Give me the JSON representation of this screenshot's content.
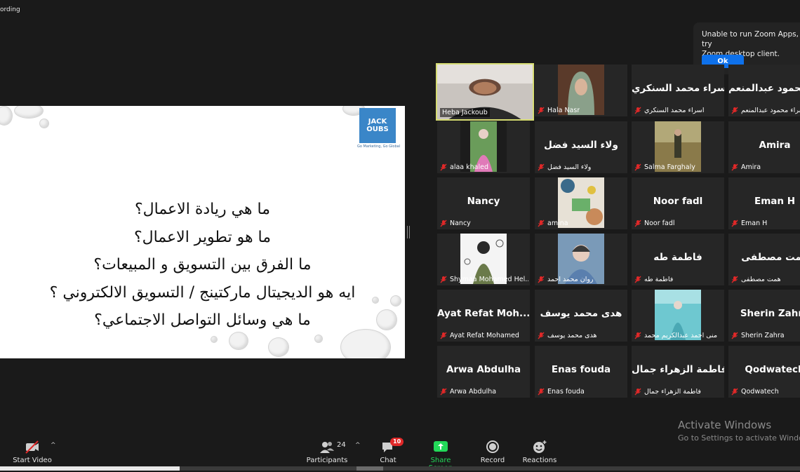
{
  "recording_text": "ording",
  "toast": {
    "message": "Unable to run Zoom Apps, try\nZoom desktop client.",
    "ok_label": "Ok"
  },
  "slide": {
    "logo_text": "JACK\nOUBS",
    "logo_tagline": "Go Marketing, Go Global",
    "questions": [
      "ما هي ريادة الاعمال؟",
      "ما هو تطوير الاعمال؟",
      "ما الفرق بين التسويق و المبيعات؟",
      "ايه هو الديجيتال ماركتينج / التسويق الالكتروني ؟",
      "ما هي وسائل التواصل الاجتماعي؟"
    ]
  },
  "participants": [
    {
      "label": "Heba Jackoub",
      "big": "",
      "muted": false,
      "active": true,
      "photo": "person"
    },
    {
      "label": "Hala Nasr",
      "big": "",
      "muted": true,
      "active": false,
      "photo": "hijab-green"
    },
    {
      "label": "اسراء محمد السنكري",
      "big": "اسراء محمد السنكري",
      "muted": true,
      "active": false,
      "photo": ""
    },
    {
      "label": "اسراء محمود عبدالمنعم",
      "big": "اسراء محمود عبدالمنعم",
      "muted": true,
      "active": false,
      "photo": ""
    },
    {
      "label": "alaa khaled",
      "big": "",
      "muted": true,
      "active": false,
      "photo": "pink-girl"
    },
    {
      "label": "ولاء السيد فضل",
      "big": "ولاء السيد فضل",
      "muted": true,
      "active": false,
      "photo": ""
    },
    {
      "label": "Salma Farghaly",
      "big": "",
      "muted": true,
      "active": false,
      "photo": "field"
    },
    {
      "label": "Amira",
      "big": "Amira",
      "muted": true,
      "active": false,
      "photo": ""
    },
    {
      "label": "Nancy",
      "big": "Nancy",
      "muted": true,
      "active": false,
      "photo": ""
    },
    {
      "label": "amina",
      "big": "",
      "muted": true,
      "active": false,
      "photo": "craft"
    },
    {
      "label": "Noor fadl",
      "big": "Noor fadl",
      "muted": true,
      "active": false,
      "photo": ""
    },
    {
      "label": "Eman H",
      "big": "Eman H",
      "muted": true,
      "active": false,
      "photo": ""
    },
    {
      "label": "Shymaa Mohamed Hel...",
      "big": "",
      "muted": true,
      "active": false,
      "photo": "cartoon"
    },
    {
      "label": "روان محمد احمد",
      "big": "",
      "muted": true,
      "active": false,
      "photo": "blue-girl"
    },
    {
      "label": "فاطمة طه",
      "big": "فاطمة طه",
      "muted": true,
      "active": false,
      "photo": ""
    },
    {
      "label": "همت مصطفى",
      "big": "همت مصطفى",
      "muted": true,
      "active": false,
      "photo": ""
    },
    {
      "label": "Ayat Refat Mohamed",
      "big": "Ayat Refat Moh...",
      "muted": true,
      "active": false,
      "photo": ""
    },
    {
      "label": "هدى محمد يوسف",
      "big": "هدى محمد يوسف",
      "muted": true,
      "active": false,
      "photo": ""
    },
    {
      "label": "منى احمد عبدالكريم محمد",
      "big": "",
      "muted": true,
      "active": false,
      "photo": "teal"
    },
    {
      "label": "Sherin Zahra",
      "big": "Sherin Zahra",
      "muted": true,
      "active": false,
      "photo": ""
    },
    {
      "label": "Arwa Abdulha",
      "big": "Arwa Abdulha",
      "muted": true,
      "active": false,
      "photo": ""
    },
    {
      "label": "Enas fouda",
      "big": "Enas fouda",
      "muted": true,
      "active": false,
      "photo": ""
    },
    {
      "label": "فاطمة الزهراء جمال",
      "big": "فاطمة الزهراء جمال",
      "muted": true,
      "active": false,
      "photo": ""
    },
    {
      "label": "Qodwatech",
      "big": "Qodwatech",
      "muted": true,
      "active": false,
      "photo": ""
    }
  ],
  "toolbar": {
    "start_video": "Start Video",
    "participants_label": "Participants",
    "participants_count": "24",
    "chat_label": "Chat",
    "chat_badge": "10",
    "share_label": "Share Screen",
    "record_label": "Record",
    "reactions_label": "Reactions"
  },
  "watermark": {
    "title": "Activate Windows",
    "subtitle": "Go to Settings to activate Windows."
  },
  "colors": {
    "accent_blue": "#0e71eb",
    "share_green": "#23d959",
    "active_border": "#d6dc73",
    "muted_red": "#e02828"
  }
}
